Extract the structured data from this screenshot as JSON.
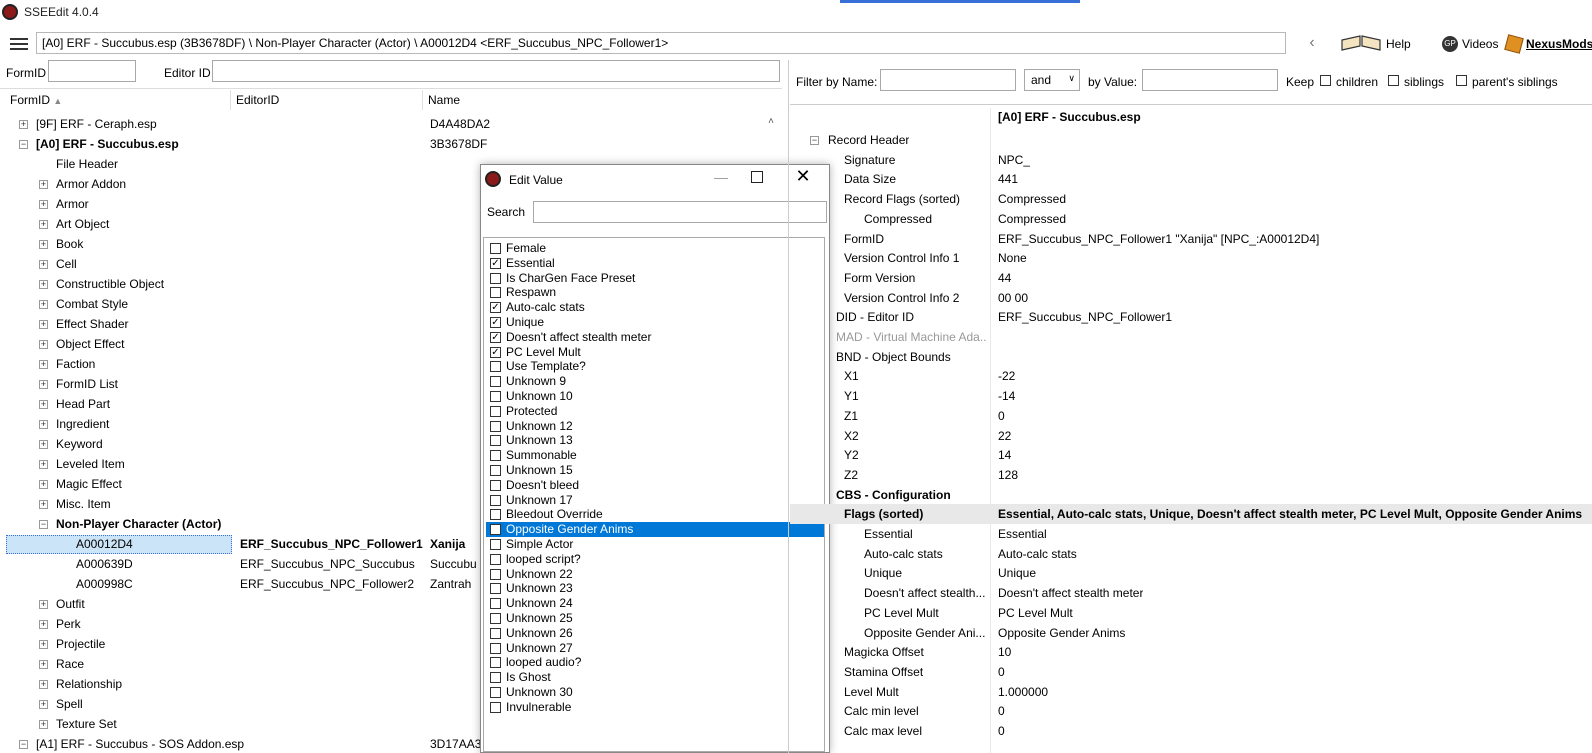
{
  "window": {
    "title": "SSEEdit 4.0.4"
  },
  "pathbar": {
    "path": "[A0] ERF - Succubus.esp (3B3678DF) \\ Non-Player Character (Actor) \\ A00012D4 <ERF_Succubus_NPC_Follower1>",
    "back_icon": "chevron-left-icon",
    "forward_icon": "chevron-right-icon",
    "help_label": "Help",
    "videos_label": "Videos",
    "nexus_label": "NexusMods"
  },
  "left_filter": {
    "formid_label": "FormID",
    "formid_value": "",
    "editorid_label": "Editor ID",
    "editorid_value": ""
  },
  "tree": {
    "columns": [
      "FormID",
      "EditorID",
      "Name"
    ],
    "rows": [
      {
        "text": "[9F] ERF - Ceraph.esp",
        "name": "D4A48DA2"
      },
      {
        "text": "[A0] ERF - Succubus.esp",
        "name": "3B3678DF"
      },
      {
        "text": "File Header"
      },
      {
        "text": "Armor Addon"
      },
      {
        "text": "Armor"
      },
      {
        "text": "Art Object"
      },
      {
        "text": "Book"
      },
      {
        "text": "Cell"
      },
      {
        "text": "Constructible Object"
      },
      {
        "text": "Combat Style"
      },
      {
        "text": "Effect Shader"
      },
      {
        "text": "Object Effect"
      },
      {
        "text": "Faction"
      },
      {
        "text": "FormID List"
      },
      {
        "text": "Head Part"
      },
      {
        "text": "Ingredient"
      },
      {
        "text": "Keyword"
      },
      {
        "text": "Leveled Item"
      },
      {
        "text": "Magic Effect"
      },
      {
        "text": "Misc. Item"
      },
      {
        "text": "Non-Player Character (Actor)"
      },
      {
        "text": "A00012D4",
        "editorid": "ERF_Succubus_NPC_Follower1",
        "name": "Xanija"
      },
      {
        "text": "A000639D",
        "editorid": "ERF_Succubus_NPC_Succubus",
        "name": "Succubu"
      },
      {
        "text": "A000998C",
        "editorid": "ERF_Succubus_NPC_Follower2",
        "name": "Zantrah"
      },
      {
        "text": "Outfit"
      },
      {
        "text": "Perk"
      },
      {
        "text": "Projectile"
      },
      {
        "text": "Race"
      },
      {
        "text": "Relationship"
      },
      {
        "text": "Spell"
      },
      {
        "text": "Texture Set"
      },
      {
        "text": "[A1] ERF - Succubus - SOS Addon.esp",
        "name": "3D17AA3"
      }
    ]
  },
  "dialog": {
    "title": "Edit Value",
    "search_label": "Search",
    "search_value": "",
    "flags": [
      {
        "label": "Female",
        "checked": false
      },
      {
        "label": "Essential",
        "checked": true
      },
      {
        "label": "Is CharGen Face Preset",
        "checked": false
      },
      {
        "label": "Respawn",
        "checked": false
      },
      {
        "label": "Auto-calc stats",
        "checked": true
      },
      {
        "label": "Unique",
        "checked": true
      },
      {
        "label": "Doesn't affect stealth meter",
        "checked": true
      },
      {
        "label": "PC Level Mult",
        "checked": true
      },
      {
        "label": "Use Template?",
        "checked": false
      },
      {
        "label": "Unknown 9",
        "checked": false
      },
      {
        "label": "Unknown 10",
        "checked": false
      },
      {
        "label": "Protected",
        "checked": false
      },
      {
        "label": "Unknown 12",
        "checked": false
      },
      {
        "label": "Unknown 13",
        "checked": false
      },
      {
        "label": "Summonable",
        "checked": false
      },
      {
        "label": "Unknown 15",
        "checked": false
      },
      {
        "label": "Doesn't bleed",
        "checked": false
      },
      {
        "label": "Unknown 17",
        "checked": false
      },
      {
        "label": "Bleedout Override",
        "checked": false
      },
      {
        "label": "Opposite Gender Anims",
        "checked": true,
        "selected": true
      },
      {
        "label": "Simple Actor",
        "checked": false
      },
      {
        "label": "looped script?",
        "checked": false
      },
      {
        "label": "Unknown 22",
        "checked": false
      },
      {
        "label": "Unknown 23",
        "checked": false
      },
      {
        "label": "Unknown 24",
        "checked": false
      },
      {
        "label": "Unknown 25",
        "checked": false
      },
      {
        "label": "Unknown 26",
        "checked": false
      },
      {
        "label": "Unknown 27",
        "checked": false
      },
      {
        "label": "looped audio?",
        "checked": false
      },
      {
        "label": "Is Ghost",
        "checked": false
      },
      {
        "label": "Unknown 30",
        "checked": false
      },
      {
        "label": "Invulnerable",
        "checked": false
      }
    ]
  },
  "right_filter": {
    "by_name_label": "Filter by Name:",
    "name_value": "",
    "op_value": "and",
    "by_value_label": "by Value:",
    "value_value": "",
    "keep_label": "Keep",
    "children_label": "children",
    "siblings_label": "siblings",
    "parents_label": "parent's siblings"
  },
  "record": {
    "file_header": "[A0] ERF - Succubus.esp",
    "rows": [
      {
        "label": "Record Header",
        "value": ""
      },
      {
        "label": "Signature",
        "value": "NPC_"
      },
      {
        "label": "Data Size",
        "value": "441"
      },
      {
        "label": "Record Flags (sorted)",
        "value": "Compressed"
      },
      {
        "label": "Compressed",
        "value": "Compressed"
      },
      {
        "label": "FormID",
        "value": "ERF_Succubus_NPC_Follower1 \"Xanija\" [NPC_:A00012D4]"
      },
      {
        "label": "Version Control Info 1",
        "value": "None"
      },
      {
        "label": "Form Version",
        "value": "44"
      },
      {
        "label": "Version Control Info 2",
        "value": "00 00"
      },
      {
        "label": "DID - Editor ID",
        "value": "ERF_Succubus_NPC_Follower1"
      },
      {
        "label": "MAD - Virtual Machine Ada...",
        "value": ""
      },
      {
        "label": "BND - Object Bounds",
        "value": ""
      },
      {
        "label": "X1",
        "value": "-22"
      },
      {
        "label": "Y1",
        "value": "-14"
      },
      {
        "label": "Z1",
        "value": "0"
      },
      {
        "label": "X2",
        "value": "22"
      },
      {
        "label": "Y2",
        "value": "14"
      },
      {
        "label": "Z2",
        "value": "128"
      },
      {
        "label": "CBS - Configuration",
        "value": ""
      },
      {
        "label": "Flags (sorted)",
        "value": "Essential, Auto-calc stats, Unique, Doesn't affect stealth meter, PC Level Mult, Opposite Gender Anims"
      },
      {
        "label": "Essential",
        "value": "Essential"
      },
      {
        "label": "Auto-calc stats",
        "value": "Auto-calc stats"
      },
      {
        "label": "Unique",
        "value": "Unique"
      },
      {
        "label": "Doesn't affect stealth...",
        "value": "Doesn't affect stealth meter"
      },
      {
        "label": "PC Level Mult",
        "value": "PC Level Mult"
      },
      {
        "label": "Opposite Gender Ani...",
        "value": "Opposite Gender Anims"
      },
      {
        "label": "Magicka Offset",
        "value": "10"
      },
      {
        "label": "Stamina Offset",
        "value": "0"
      },
      {
        "label": "Level Mult",
        "value": "1.000000"
      },
      {
        "label": "Calc min level",
        "value": "0"
      },
      {
        "label": "Calc max level",
        "value": "0"
      }
    ]
  }
}
